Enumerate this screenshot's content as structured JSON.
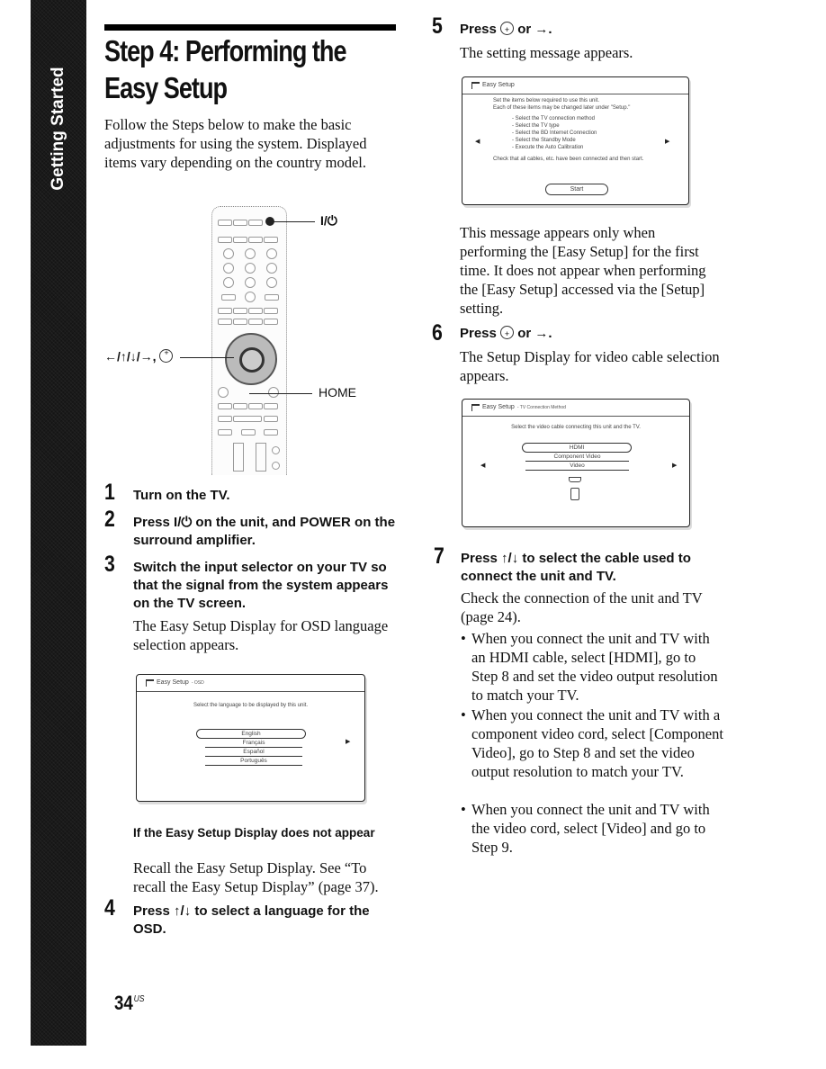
{
  "sidebar": {
    "label": "Getting Started"
  },
  "title": {
    "line1": "Step 4: Performing the",
    "line2": "Easy Setup"
  },
  "intro": "Follow the Steps below to make the basic adjustments for using the system. Displayed items vary depending on the country model.",
  "remote": {
    "callouts": {
      "power": "I/⏻",
      "arrows": "←/↑/↓/→,",
      "home": "HOME"
    }
  },
  "steps": [
    {
      "num": "1",
      "title": "Turn on the TV."
    },
    {
      "num": "2",
      "title": "Press I/⏻ on the unit, and POWER on the surround amplifier."
    },
    {
      "num": "3",
      "title": "Switch the input selector on your TV so that the signal from the system appears on the TV screen.",
      "body": "The Easy Setup Display for OSD language selection appears."
    },
    {
      "num": "4",
      "title": "Press ↑/↓ to select a language for the OSD."
    },
    {
      "num": "5",
      "title_pre": "Press",
      "title_post": "or →.",
      "body": "The setting message appears.",
      "note": "This message appears only when performing the [Easy Setup] for the first time. It does not appear when performing the [Easy Setup] accessed via the [Setup] setting."
    },
    {
      "num": "6",
      "title_pre": "Press",
      "title_post": "or →.",
      "body": "The Setup Display for video cable selection appears."
    },
    {
      "num": "7",
      "title": "Press ↑/↓ to select the cable used to connect the unit and TV.",
      "body": "Check the connection of the unit and TV (page 24).",
      "bullets": [
        "When you connect the unit and TV with an HDMI cable, select [HDMI], go to Step 8 and set the video output resolution to match your TV.",
        "When you connect the unit and TV with a component video cord, select [Component Video], go to Step 8 and set the video output resolution to match your TV.",
        "When you connect the unit and TV with the video cord, select [Video] and go to Step 9."
      ]
    }
  ],
  "troubleshoot": {
    "heading": "If the Easy Setup Display does not appear",
    "body": "Recall the Easy Setup Display. See “To recall the Easy Setup Display” (page 37)."
  },
  "osd_language": {
    "header": "Easy Setup",
    "header_sub": "- OSD",
    "prompt": "Select the language to be displayed by this unit.",
    "options": [
      "English",
      "Français",
      "Español",
      "Português"
    ],
    "selected": "English",
    "arrow_right": "▶"
  },
  "osd_message": {
    "header": "Easy Setup",
    "line1": "Set the items below required to use this unit.",
    "line2": "Each of these items may be changed later under \"Setup.\"",
    "items": [
      "- Select the TV connection method",
      "- Select the TV type",
      "- Select the BD Internet Connection",
      "- Select the Standby Mode",
      "- Execute the Auto Calibration"
    ],
    "footer": "Check that all cables, etc. have been connected and then start.",
    "button": "Start",
    "arrow_left": "◀",
    "arrow_right": "▶"
  },
  "osd_cable": {
    "header": "Easy Setup",
    "header_sub": "- TV Connection Method",
    "prompt": "Select the video cable connecting this unit and the TV.",
    "options": [
      "HDMI",
      "Component Video",
      "Video"
    ],
    "selected": "HDMI",
    "arrow_left": "◀",
    "arrow_right": "▶"
  },
  "page": {
    "number": "34",
    "suffix": "US"
  }
}
